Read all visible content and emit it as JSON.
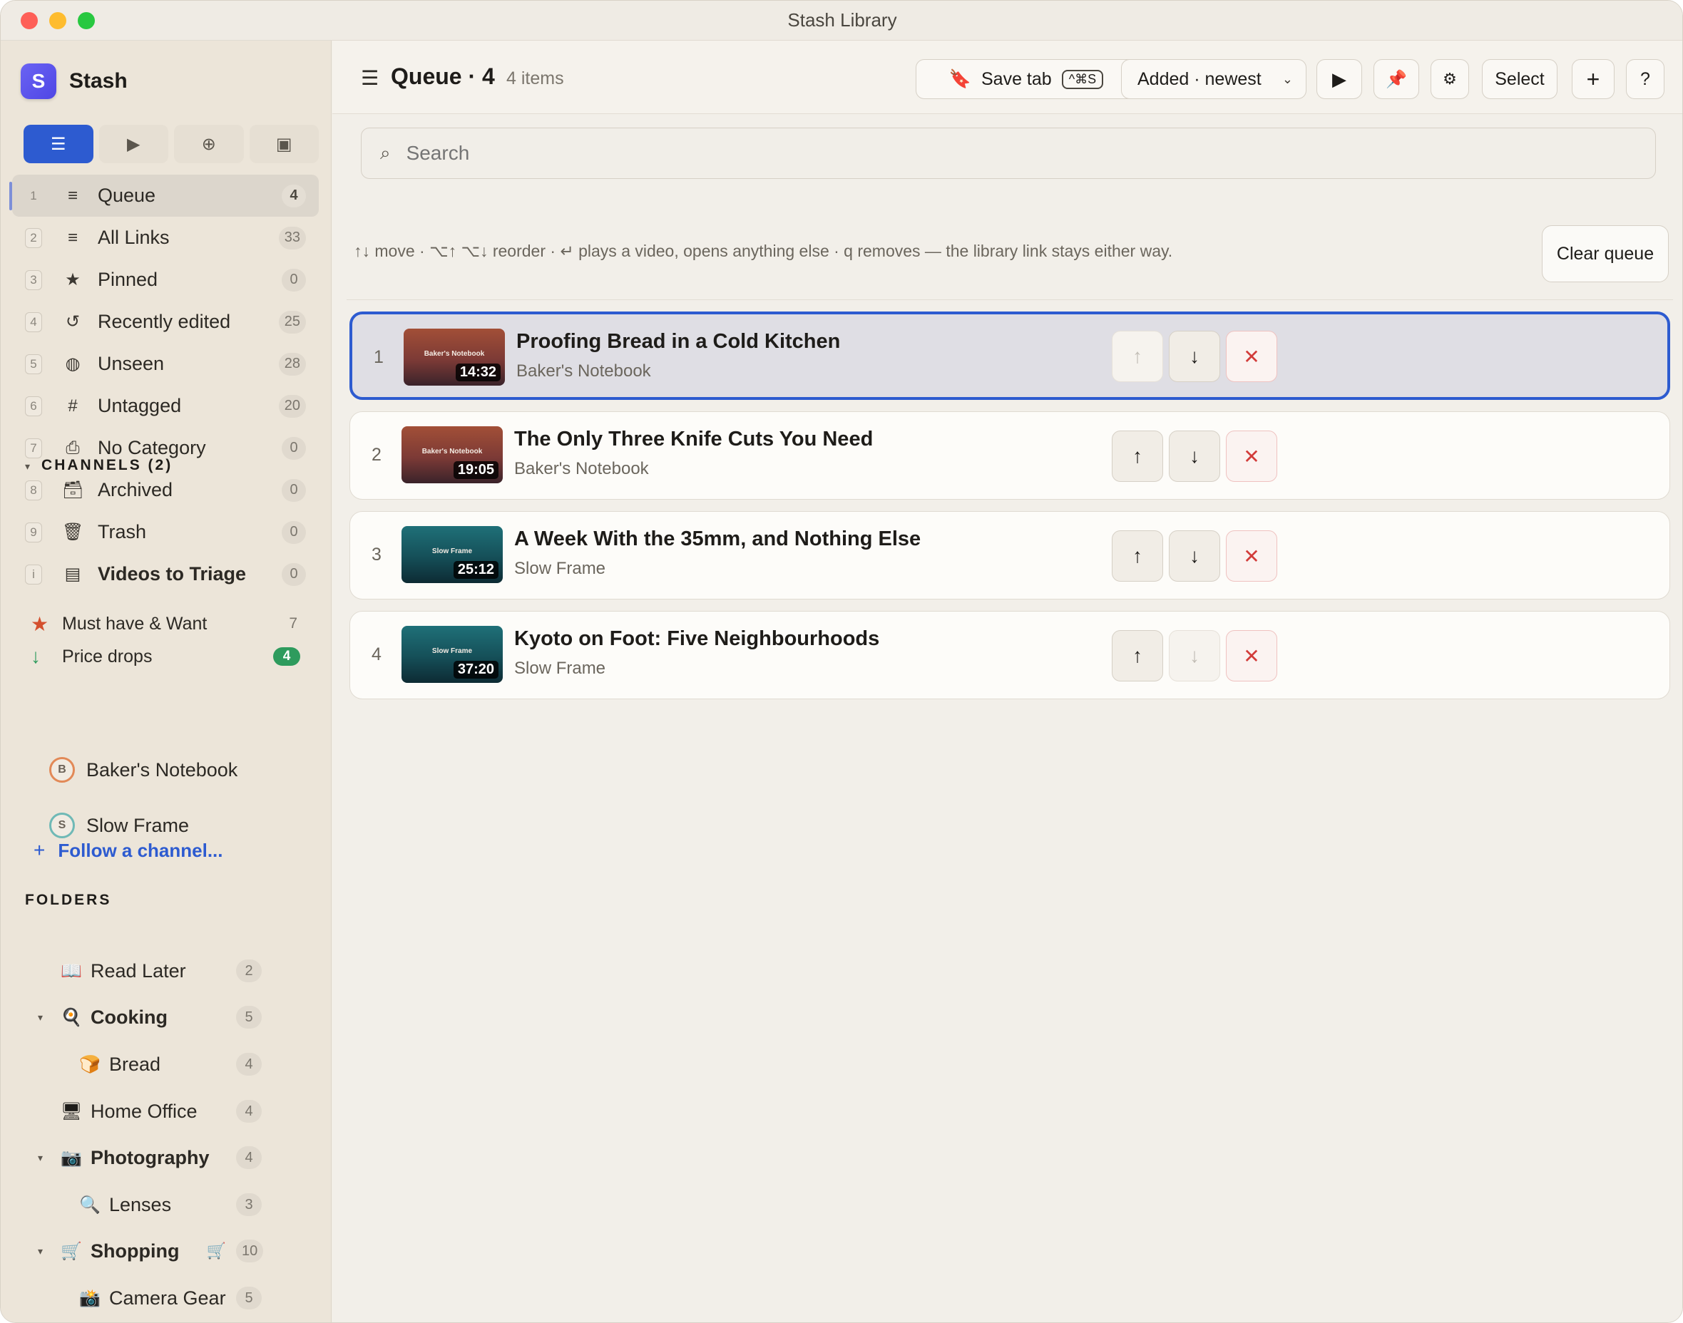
{
  "window": {
    "title": "Stash Library"
  },
  "brand": {
    "logo_letter": "S",
    "name": "Stash"
  },
  "view_switch": [
    {
      "icon": "list-icon",
      "glyph": "☰",
      "active": true
    },
    {
      "icon": "play-icon",
      "glyph": "▶",
      "active": false
    },
    {
      "icon": "globe-icon",
      "glyph": "⊕",
      "active": false
    },
    {
      "icon": "image-icon",
      "glyph": "▣",
      "active": false
    }
  ],
  "nav": [
    {
      "key": "1",
      "icon": "≡",
      "label": "Queue",
      "count": "4",
      "active": true
    },
    {
      "key": "2",
      "icon": "≡",
      "label": "All Links",
      "count": "33"
    },
    {
      "key": "3",
      "icon": "★",
      "label": "Pinned",
      "count": "0"
    },
    {
      "key": "4",
      "icon": "↺",
      "label": "Recently edited",
      "count": "25"
    },
    {
      "key": "5",
      "icon": "◍",
      "label": "Unseen",
      "count": "28"
    },
    {
      "key": "6",
      "icon": "#",
      "label": "Untagged",
      "count": "20"
    },
    {
      "key": "7",
      "icon": "⎙",
      "label": "No Category",
      "count": "0"
    },
    {
      "key": "8",
      "icon": "🗃",
      "label": "Archived",
      "count": "0"
    },
    {
      "key": "9",
      "icon": "🗑",
      "label": "Trash",
      "count": "0"
    },
    {
      "key": "i",
      "icon": "▤",
      "label": "Videos to Triage",
      "count": "0",
      "bold": true
    }
  ],
  "smart_lists": [
    {
      "icon": "★",
      "label": "Must have & Want",
      "count": "7",
      "color": "#d4502e"
    },
    {
      "icon": "↓",
      "label": "Price drops",
      "count": "4",
      "color": "#2e9b5d"
    }
  ],
  "channels": {
    "heading": "CHANNELS (2)",
    "items": [
      {
        "initial": "B",
        "label": "Baker's Notebook"
      },
      {
        "initial": "S",
        "label": "Slow Frame"
      }
    ],
    "follow_label": "Follow a channel..."
  },
  "folders": {
    "heading": "FOLDERS",
    "items": [
      {
        "icon": "📖",
        "label": "Read Later",
        "count": "2"
      },
      {
        "icon": "🍳",
        "label": "Cooking",
        "count": "5",
        "expanded": true,
        "bold": true
      },
      {
        "icon": "🍞",
        "label": "Bread",
        "count": "4",
        "child": true
      },
      {
        "icon": "🖥",
        "label": "Home Office",
        "count": "4"
      },
      {
        "icon": "📷",
        "label": "Photography",
        "count": "4",
        "expanded": true,
        "bold": true
      },
      {
        "icon": "🔍",
        "label": "Lenses",
        "count": "3",
        "child": true
      },
      {
        "icon": "🛒",
        "label": "Shopping",
        "count": "10",
        "expanded": true,
        "bold": true,
        "extra": "🛒"
      },
      {
        "icon": "📸",
        "label": "Camera Gear",
        "count": "5",
        "child": true
      }
    ]
  },
  "header": {
    "title": "Queue · 4",
    "subtitle": "4 items",
    "save_tab_label": "Save tab",
    "save_tab_shortcut": "^⌘S",
    "sort_label": "Added · newest",
    "select_label": "Select",
    "add_label": "+",
    "help_label": "?"
  },
  "search": {
    "placeholder": "Search"
  },
  "hint": "↑↓ move · ⌥↑ ⌥↓ reorder · ↵ plays a video, opens anything else · q removes — the library link stays either way.",
  "clear_queue_label": "Clear queue",
  "queue": [
    {
      "num": "1",
      "title": "Proofing Bread in a Cold Kitchen",
      "channel": "Baker's Notebook",
      "duration": "14:32",
      "thumb": "warm",
      "selected": true,
      "up_disabled": true,
      "down_disabled": false
    },
    {
      "num": "2",
      "title": "The Only Three Knife Cuts You Need",
      "channel": "Baker's Notebook",
      "duration": "19:05",
      "thumb": "warm",
      "selected": false,
      "up_disabled": false,
      "down_disabled": false
    },
    {
      "num": "3",
      "title": "A Week With the 35mm, and Nothing Else",
      "channel": "Slow Frame",
      "duration": "25:12",
      "thumb": "cool",
      "selected": false,
      "up_disabled": false,
      "down_disabled": false
    },
    {
      "num": "4",
      "title": "Kyoto on Foot: Five Neighbourhoods",
      "channel": "Slow Frame",
      "duration": "37:20",
      "thumb": "cool",
      "selected": false,
      "up_disabled": false,
      "down_disabled": true
    }
  ]
}
